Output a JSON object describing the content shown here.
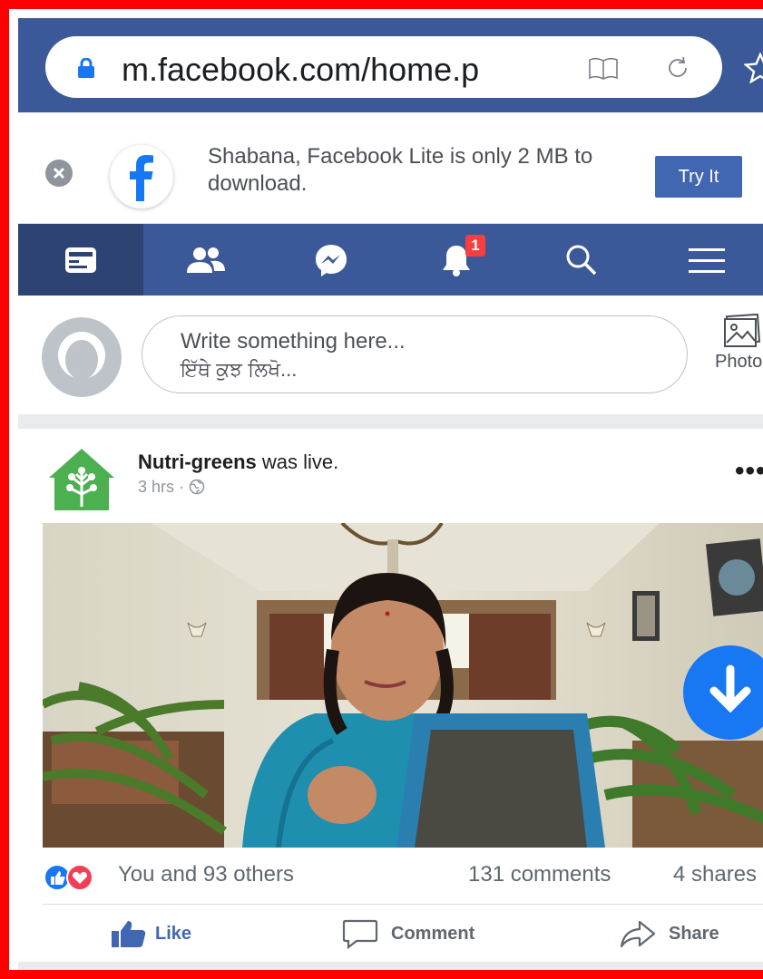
{
  "browser": {
    "url": "m.facebook.com/home.p"
  },
  "lite_banner": {
    "message": "Shabana, Facebook Lite is only 2 MB to download.",
    "button_label": "Try It"
  },
  "nav": {
    "items": [
      {
        "name": "news-feed",
        "icon": "news-feed-icon",
        "active": true
      },
      {
        "name": "friends",
        "icon": "friends-icon"
      },
      {
        "name": "messenger",
        "icon": "messenger-icon"
      },
      {
        "name": "notifications",
        "icon": "bell-icon",
        "badge": "1"
      },
      {
        "name": "search",
        "icon": "search-icon"
      },
      {
        "name": "menu",
        "icon": "hamburger-icon"
      }
    ]
  },
  "composer": {
    "placeholder_line1": "Write something here...",
    "placeholder_line2": "ਇੱਥੇ ਕੁਝ ਲਿਖੋ...",
    "photo_label": "Photo"
  },
  "post": {
    "page_name": "Nutri-greens",
    "action": " was live.",
    "time": "3 hrs ·",
    "more": "•••",
    "likes_text": "You and 93 others",
    "comments_text": "131 comments",
    "shares_text": "4 shares",
    "actions": {
      "like": "Like",
      "comment": "Comment",
      "share": "Share"
    }
  },
  "colors": {
    "facebook_blue": "#3b5998",
    "button_blue": "#4267b2",
    "notification_red": "#fa3e3e",
    "frame_red": "#ff0000"
  }
}
